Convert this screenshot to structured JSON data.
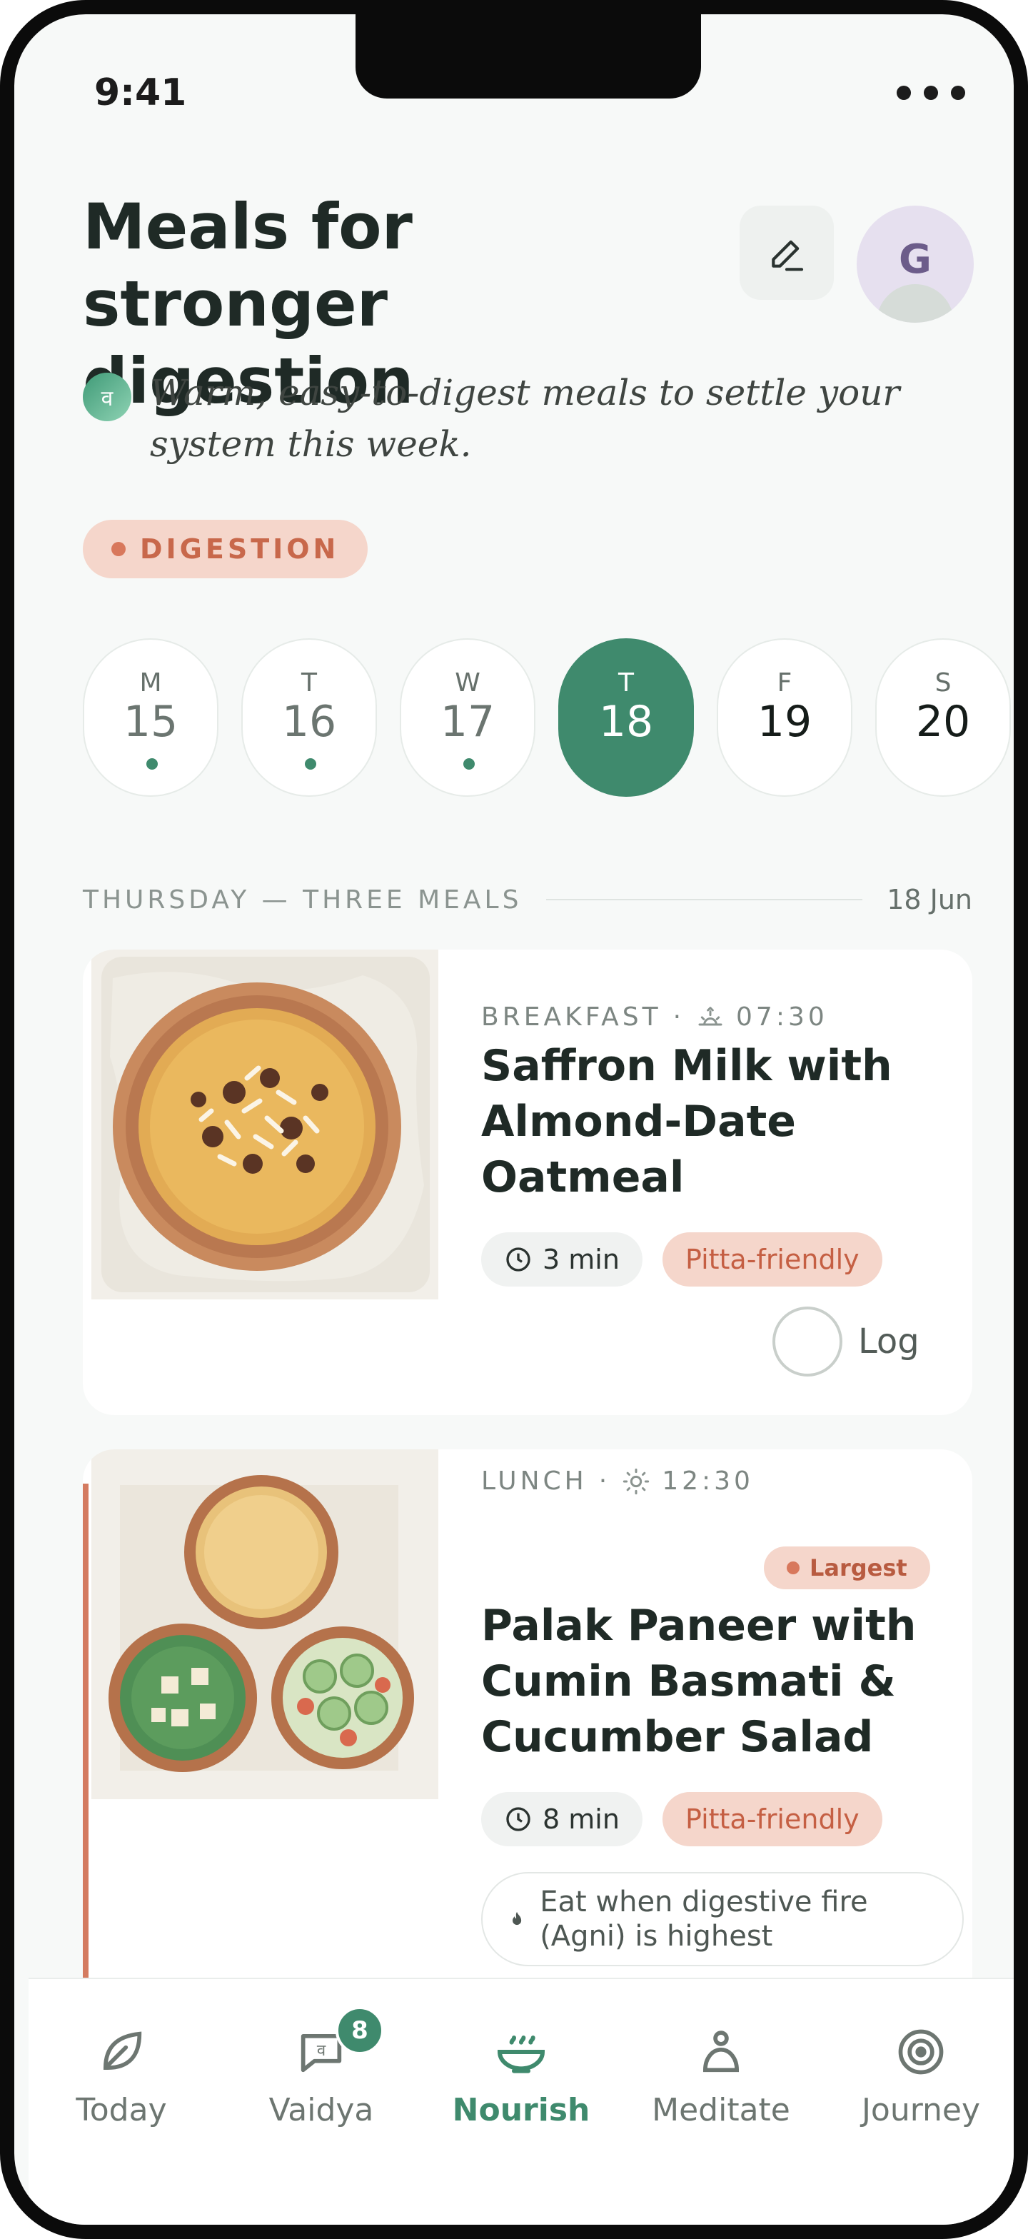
{
  "status": {
    "time": "9:41"
  },
  "header": {
    "title": "Meals for stronger digestion",
    "avatar_initial": "G",
    "vaidya_glyph": "व",
    "subtitle": "Warm, easy-to-digest meals to settle your system this week.",
    "tag": "DIGESTION"
  },
  "days": [
    {
      "letter": "M",
      "num": "15",
      "state": "past",
      "logged": true
    },
    {
      "letter": "T",
      "num": "16",
      "state": "past",
      "logged": true
    },
    {
      "letter": "W",
      "num": "17",
      "state": "past",
      "logged": true
    },
    {
      "letter": "T",
      "num": "18",
      "state": "active",
      "logged": false
    },
    {
      "letter": "F",
      "num": "19",
      "state": "future",
      "logged": false
    },
    {
      "letter": "S",
      "num": "20",
      "state": "future",
      "logged": false
    }
  ],
  "section": {
    "label": "THURSDAY — THREE MEALS",
    "date": "18 Jun"
  },
  "meals": [
    {
      "type": "BREAKFAST",
      "time": "07:30",
      "time_icon": "sunrise-icon",
      "title": "Saffron Milk with Almond-Date Oatmeal",
      "duration": "3 min",
      "dosha": "Pitta-friendly",
      "log_label": "Log"
    },
    {
      "type": "LUNCH",
      "time": "12:30",
      "time_icon": "sun-icon",
      "badge": "Largest",
      "title": "Palak Paneer with Cumin Basmati & Cucumber Salad",
      "duration": "8 min",
      "dosha": "Pitta-friendly",
      "tip": "Eat when digestive fire (Agni) is highest"
    }
  ],
  "tabs": [
    {
      "label": "Today",
      "icon": "leaf-icon"
    },
    {
      "label": "Vaidya",
      "icon": "chat-icon",
      "badge": "8"
    },
    {
      "label": "Nourish",
      "icon": "bowl-icon",
      "active": true
    },
    {
      "label": "Meditate",
      "icon": "meditate-icon"
    },
    {
      "label": "Journey",
      "icon": "target-icon"
    }
  ],
  "colors": {
    "accent": "#3f8a6d",
    "terracotta": "#d8785c",
    "tag_bg": "#f5d6cb",
    "background": "#f7f9f8"
  }
}
